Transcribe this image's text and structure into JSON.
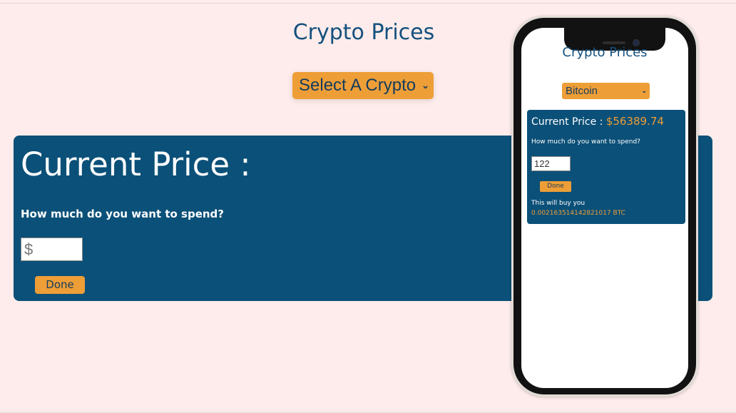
{
  "page": {
    "title": "Crypto Prices",
    "select_label": "Select A Crypto",
    "select_chevron": "⌄"
  },
  "card": {
    "current_price_label": "Current Price :",
    "spend_question": "How much do you want to spend?",
    "amount_placeholder": "$",
    "done_label": "Done"
  },
  "mobile": {
    "title": "Crypto Prices",
    "selected_crypto": "Bitcoin",
    "select_chevron": "⌄",
    "current_price_label": "Current Price :",
    "current_price_value": "$56389.74",
    "spend_question": "How much do you want to spend?",
    "amount_value": "122",
    "done_label": "Done",
    "buy_label": "This will buy you",
    "buy_result": "0.002163514142821017 BTC"
  },
  "colors": {
    "background": "#fdeceb",
    "card": "#0b5078",
    "accent": "#ee9e37",
    "title": "#13507e"
  }
}
